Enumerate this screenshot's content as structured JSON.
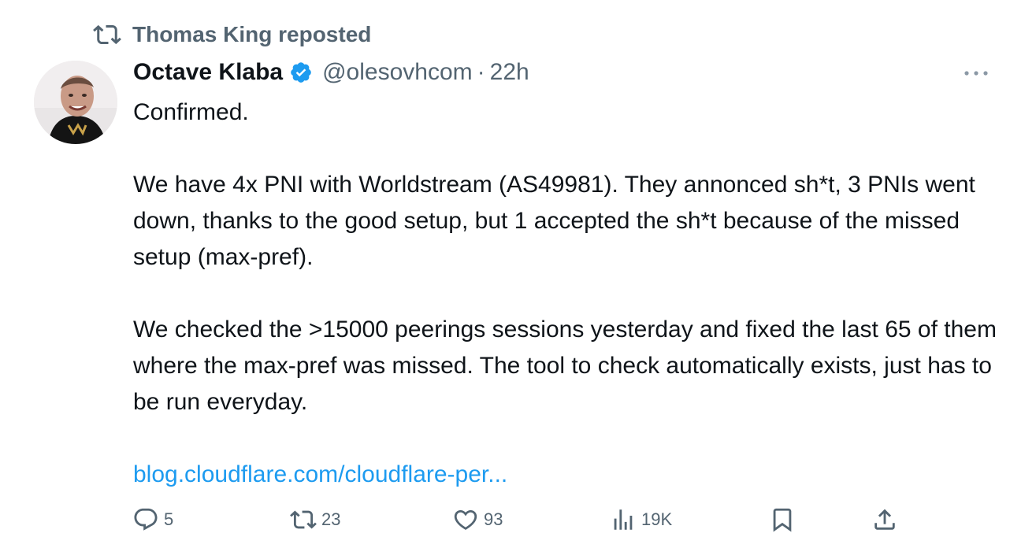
{
  "repost": {
    "icon": "repost-icon",
    "text": "Thomas King reposted"
  },
  "author": {
    "avatar_icon": "avatar",
    "name": "Octave Klaba",
    "verified_icon": "verified-badge-icon",
    "handle": "@olesovhcom",
    "separator": "·",
    "time": "22h"
  },
  "more_icon": "more-icon",
  "body": {
    "paragraphs": [
      "Confirmed.",
      "We have 4x PNI with Worldstream (AS49981). They annonced sh*t, 3 PNIs went down, thanks to the good setup, but 1 accepted the sh*t because of the missed setup (max-pref).",
      "We checked the >15000 peerings sessions yesterday and fixed the last 65 of them where the max-pref was missed. The tool to check automatically exists, just has to be run everyday."
    ],
    "link": "blog.cloudflare.com/cloudflare-per..."
  },
  "actions": {
    "reply": {
      "icon": "reply-icon",
      "count": "5"
    },
    "repost": {
      "icon": "repost-icon",
      "count": "23"
    },
    "like": {
      "icon": "heart-icon",
      "count": "93"
    },
    "views": {
      "icon": "views-icon",
      "count": "19K"
    },
    "bookmark": {
      "icon": "bookmark-icon"
    },
    "share": {
      "icon": "share-icon"
    }
  },
  "colors": {
    "text": "#0f1419",
    "muted": "#536471",
    "link": "#1d9bf0",
    "verified": "#1d9bf0"
  }
}
